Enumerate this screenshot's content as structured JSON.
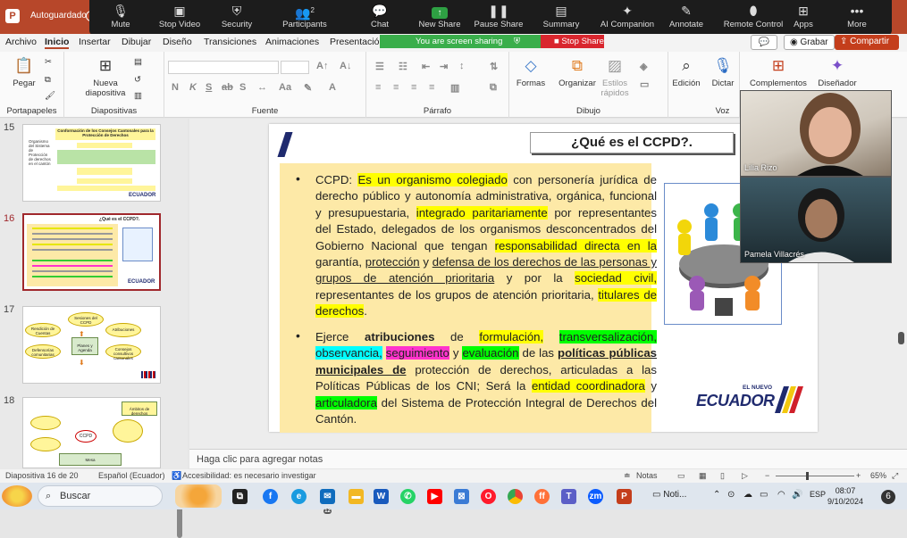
{
  "titlebar": {
    "autosave_label": "Autoguardado",
    "app_logo": "P"
  },
  "zoom_toolbar": {
    "items": [
      {
        "label": "Mute",
        "icon": "mic-icon"
      },
      {
        "label": "Stop Video",
        "icon": "video-icon"
      },
      {
        "label": "Security",
        "icon": "shield-icon"
      },
      {
        "label": "Participants",
        "icon": "people-icon",
        "count": "2"
      },
      {
        "label": "Chat",
        "icon": "chat-icon"
      },
      {
        "label": "New Share",
        "icon": "share-up-icon"
      },
      {
        "label": "Pause Share",
        "icon": "pause-icon"
      },
      {
        "label": "Summary",
        "icon": "summary-icon"
      },
      {
        "label": "AI Companion",
        "icon": "sparkle-icon"
      },
      {
        "label": "Annotate",
        "icon": "pen-icon"
      },
      {
        "label": "Remote Control",
        "icon": "mouse-icon"
      },
      {
        "label": "Apps",
        "icon": "apps-icon"
      },
      {
        "label": "More",
        "icon": "more-icon"
      }
    ],
    "sharing_banner": "You are screen sharing",
    "stop_share": "Stop Share"
  },
  "menu": {
    "tabs": [
      "Archivo",
      "Inicio",
      "Insertar",
      "Dibujar",
      "Diseño",
      "Transiciones",
      "Animaciones",
      "Presentación"
    ],
    "record_label": "Grabar",
    "share_label": "Compartir"
  },
  "ribbon": {
    "paste": "Pegar",
    "new_slide": "Nueva diapositiva",
    "groups": [
      "Portapapeles",
      "Diapositivas",
      "Fuente",
      "Párrafo",
      "Dibujo",
      "Voz"
    ],
    "shapes": "Formas",
    "arrange": "Organizar",
    "quick_styles": "Estilos rápidos",
    "edit": "Edición",
    "dictate": "Dictar",
    "addins": "Complementos",
    "designer": "Diseñador",
    "font_buttons": [
      "N",
      "K",
      "S",
      "ab",
      "S"
    ]
  },
  "thumbnails": {
    "numbers": [
      "15",
      "16",
      "17",
      "18"
    ],
    "selected": "16",
    "t15_title": "Conformación de los Consejos Cantonales para la Protección de Derechos",
    "t15_side": "Organismo del Sistema de Protección de derechos en el cantón",
    "t16_title": "¿Qué es el CCPD?.",
    "t17_boxes": [
      "Sesiones del CCPD",
      "Atribuciones",
      "Rendición de Cuentas",
      "Defensorías comunitarias",
      "Consejos consultivos cantonales",
      "Planes y Agenda"
    ],
    "t18_boxes": [
      "Ámbitos de derechos",
      "CCPD",
      "Mesa"
    ],
    "brand": "ECUADOR"
  },
  "slide": {
    "title": "¿Qué es el CCPD?.",
    "brand_small": "EL NUEVO",
    "brand_big": "ECUADOR",
    "p1": {
      "intro": "CCPD: ",
      "t1": "Es un organismo colegiado",
      "t2": " con personería jurídica de derecho público y autonomía administrativa, orgánica, funcional y presupuestaria, ",
      "t3": "integrado paritariamente",
      "t4": " por representantes del Estado, delegados de los organismos desconcentrados del Gobierno Nacional que tengan ",
      "t5": "responsabilidad directa en la",
      "t6": " garantía, ",
      "t7": "protección",
      "t8": " y ",
      "t9": "defensa de los derechos de las personas y grupos de atención prioritaria",
      "t10": " y por la ",
      "t11": "sociedad civil,",
      "t12": " representantes de los grupos de atención prioritaria, ",
      "t13": " titulares de derechos",
      "t14": "."
    },
    "p2": {
      "t1": "Ejerce ",
      "t2": "atribuciones",
      "t3": " de ",
      "t4": "formulación,",
      "t5": " ",
      "t6": "transversalización,",
      "t7": " ",
      "t8": "observancia,",
      "t9": " ",
      "t10": "seguimiento",
      "t11": " y ",
      "t12": "evaluación",
      "t13": " de las ",
      "t14": "políticas públicas municipales de",
      "t15": " protección de derechos, articuladas a las Políticas Públicas de los CNI; Será la ",
      "t16": "entidad coordinadora",
      "t17": " y ",
      "t18": "articuladora",
      "t19": " del Sistema de Protección Integral de Derechos del Cantón."
    }
  },
  "notes_placeholder": "Haga clic para agregar notas",
  "status": {
    "slide_pos": "Diapositiva 16 de 20",
    "language": "Español (Ecuador)",
    "accessibility": "Accesibilidad: es necesario investigar",
    "notes": "Notas",
    "zoom": "65%"
  },
  "participants": [
    {
      "name": "Lilia Rizo"
    },
    {
      "name": "Pamela Villacrés"
    }
  ],
  "taskbar": {
    "search_placeholder": "Buscar",
    "mail_badge": "12",
    "window_label": "Noti...",
    "lang": "ESP",
    "time": "08:07",
    "date": "9/10/2024",
    "notif_count": "6"
  }
}
